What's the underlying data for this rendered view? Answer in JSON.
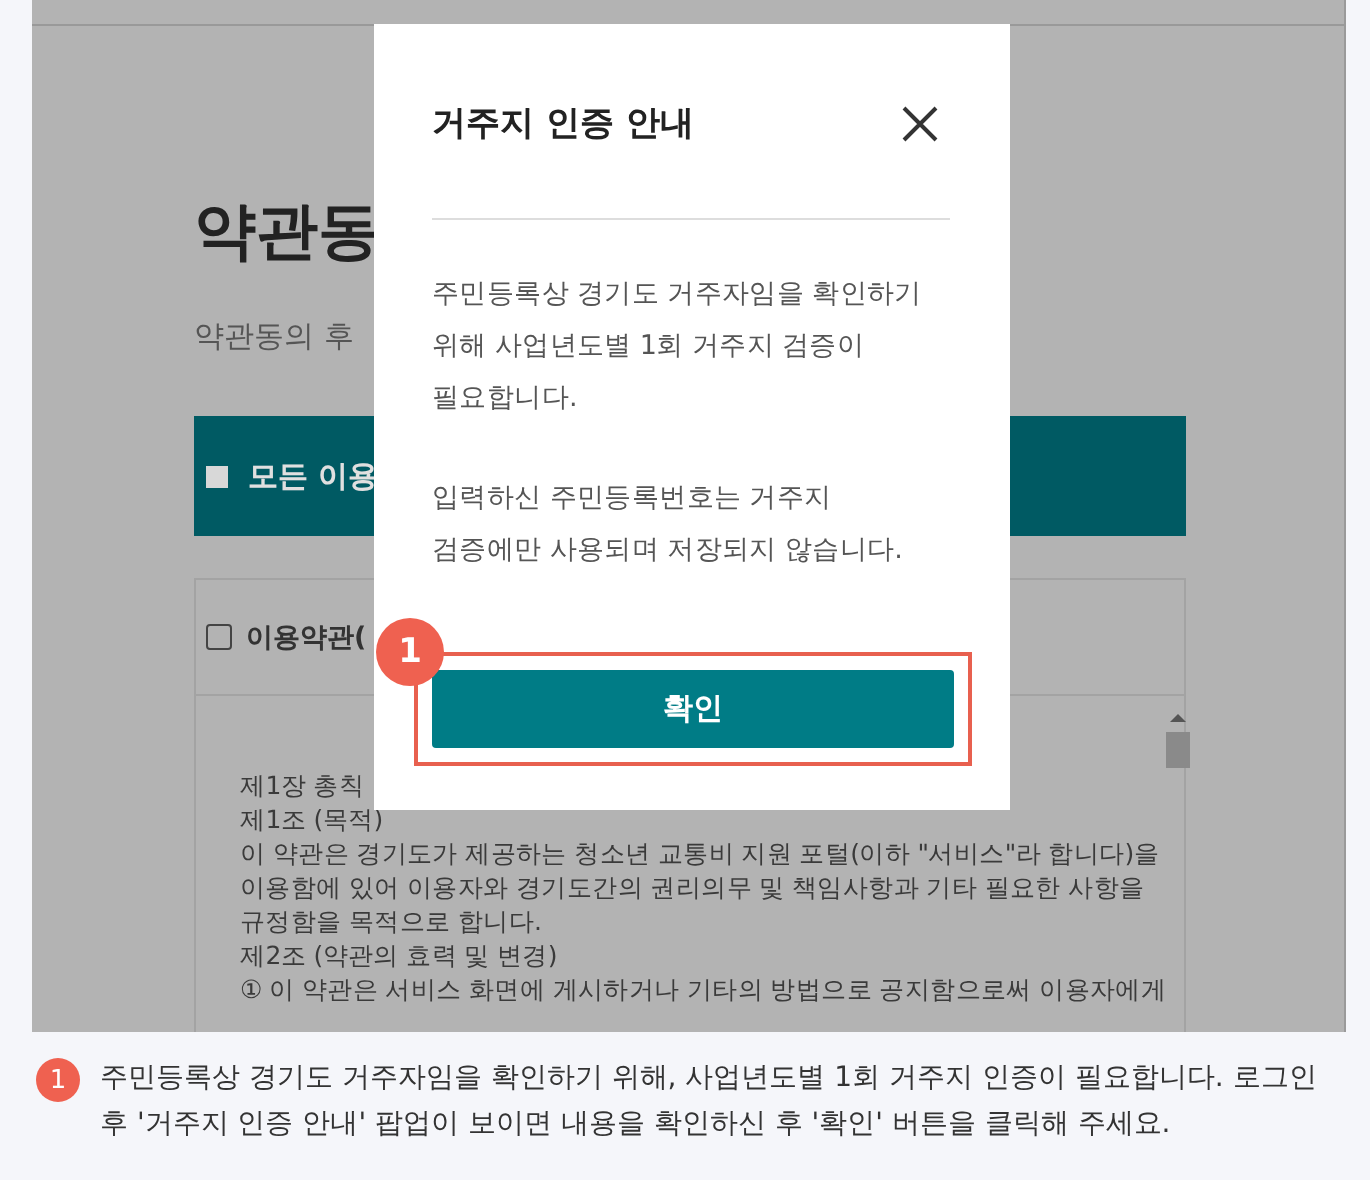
{
  "background_page": {
    "title": "약관동",
    "subtitle": "약관동의 후",
    "agree_all": {
      "label": "모든 이용"
    },
    "terms": {
      "label": "이용약관(",
      "lines": [
        "제1장 총칙",
        "제1조 (목적)",
        "이 약관은 경기도가 제공하는 청소년 교통비 지원 포털(이하 \"서비스\"라 합니다)을",
        "이용함에 있어 이용자와 경기도간의 권리의무 및 책임사항과 기타 필요한 사항을",
        "규정함을 목적으로 합니다.",
        "제2조 (약관의 효력 및 변경)",
        "① 이 약관은 서비스 화면에 게시하거나 기타의 방법으로 공지함으로써 이용자에게"
      ]
    }
  },
  "dialog": {
    "title": "거주지 인증 안내",
    "paragraphs": [
      [
        "주민등록상 경기도 거주자임을 확인하기",
        "위해 사업년도별 1회 거주지 검증이",
        "필요합니다."
      ],
      [
        "입력하신 주민등록번호는 거주지",
        "검증에만 사용되며 저장되지 않습니다."
      ]
    ],
    "confirm_button": "확인",
    "callout_number": "1"
  },
  "caption": {
    "number": "1",
    "text": "주민등록상 경기도 거주자임을 확인하기 위해, 사업년도별 1회 거주지 인증이 필요합니다. 로그인 후 '거주지 인증 안내' 팝업이 보이면 내용을 확인하신 후 '확인' 버튼을 클릭해 주세요."
  }
}
